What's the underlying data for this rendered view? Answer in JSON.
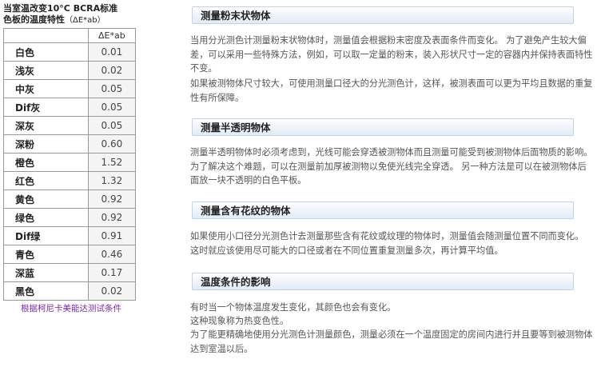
{
  "left": {
    "caption_line1": "当室温改变10°C BCRA标准",
    "caption_line2_a": "色板的温度特性",
    "caption_line2_b": "（ΔE*ab）",
    "header_delta": "ΔE*ab",
    "rows": [
      {
        "name": "白色",
        "value": "0.01"
      },
      {
        "name": "浅灰",
        "value": "0.02"
      },
      {
        "name": "中灰",
        "value": "0.05"
      },
      {
        "name": "Dif灰",
        "value": "0.05"
      },
      {
        "name": "深灰",
        "value": "0.05"
      },
      {
        "name": "深粉",
        "value": "0.60"
      },
      {
        "name": "橙色",
        "value": "1.52"
      },
      {
        "name": "红色",
        "value": "1.32"
      },
      {
        "name": "黄色",
        "value": "0.92"
      },
      {
        "name": "绿色",
        "value": "0.92"
      },
      {
        "name": "Dif绿",
        "value": "0.91"
      },
      {
        "name": "青色",
        "value": "0.46"
      },
      {
        "name": "深蓝",
        "value": "0.17"
      },
      {
        "name": "黑色",
        "value": "0.02"
      }
    ],
    "note": "根据柯尼卡美能达测试条件",
    "note_color": "#7a2aa8"
  },
  "sections": [
    {
      "title": "测量粉末状物体",
      "paragraphs": [
        "当用分光测色计测量粉末状物体时，测量值会根据粉末密度及表面条件而变化。 为了避免产生较大偏差，可以采用一些特殊方法，例如，可以取一定量的粉末，装入形状尺寸一定的容器内并保持表面特性不变。",
        "如果被测物体尺寸较大，可使用测量口径大的分光测色计，这样，被测表面可以更为平均且数据的重复性有所保障。"
      ]
    },
    {
      "title": "测量半透明物体",
      "paragraphs": [
        "测量半透明物体时必须考虑到，光线可能会穿透被测物体而且测量可能受到被测物体后面物质的影响。 为了解决这个难题，可以在测量前加厚被测物以免使光线完全穿透。 另一种方法是可以在被测物体后面放一块不透明的白色平板。"
      ]
    },
    {
      "title": "测量含有花纹的物体",
      "paragraphs": [
        "如果使用小口径分光测色计去测量那些含有花纹或纹理的物体时，测量值会随测量位置不同而变化。 这时就应该使用尽可能大的口径或者在不同位置重复测量多次，再计算平均值。"
      ]
    },
    {
      "title": "温度条件的影响",
      "paragraphs": [
        "有时当一个物体温度发生变化，其颜色也会有变化。",
        "这种现象称为热变色性。",
        "为了能更精确地使用分光测色计测量颜色，测量必须在一个温度固定的房间内进行并且要等到被测物体达到室温以后。"
      ]
    }
  ]
}
